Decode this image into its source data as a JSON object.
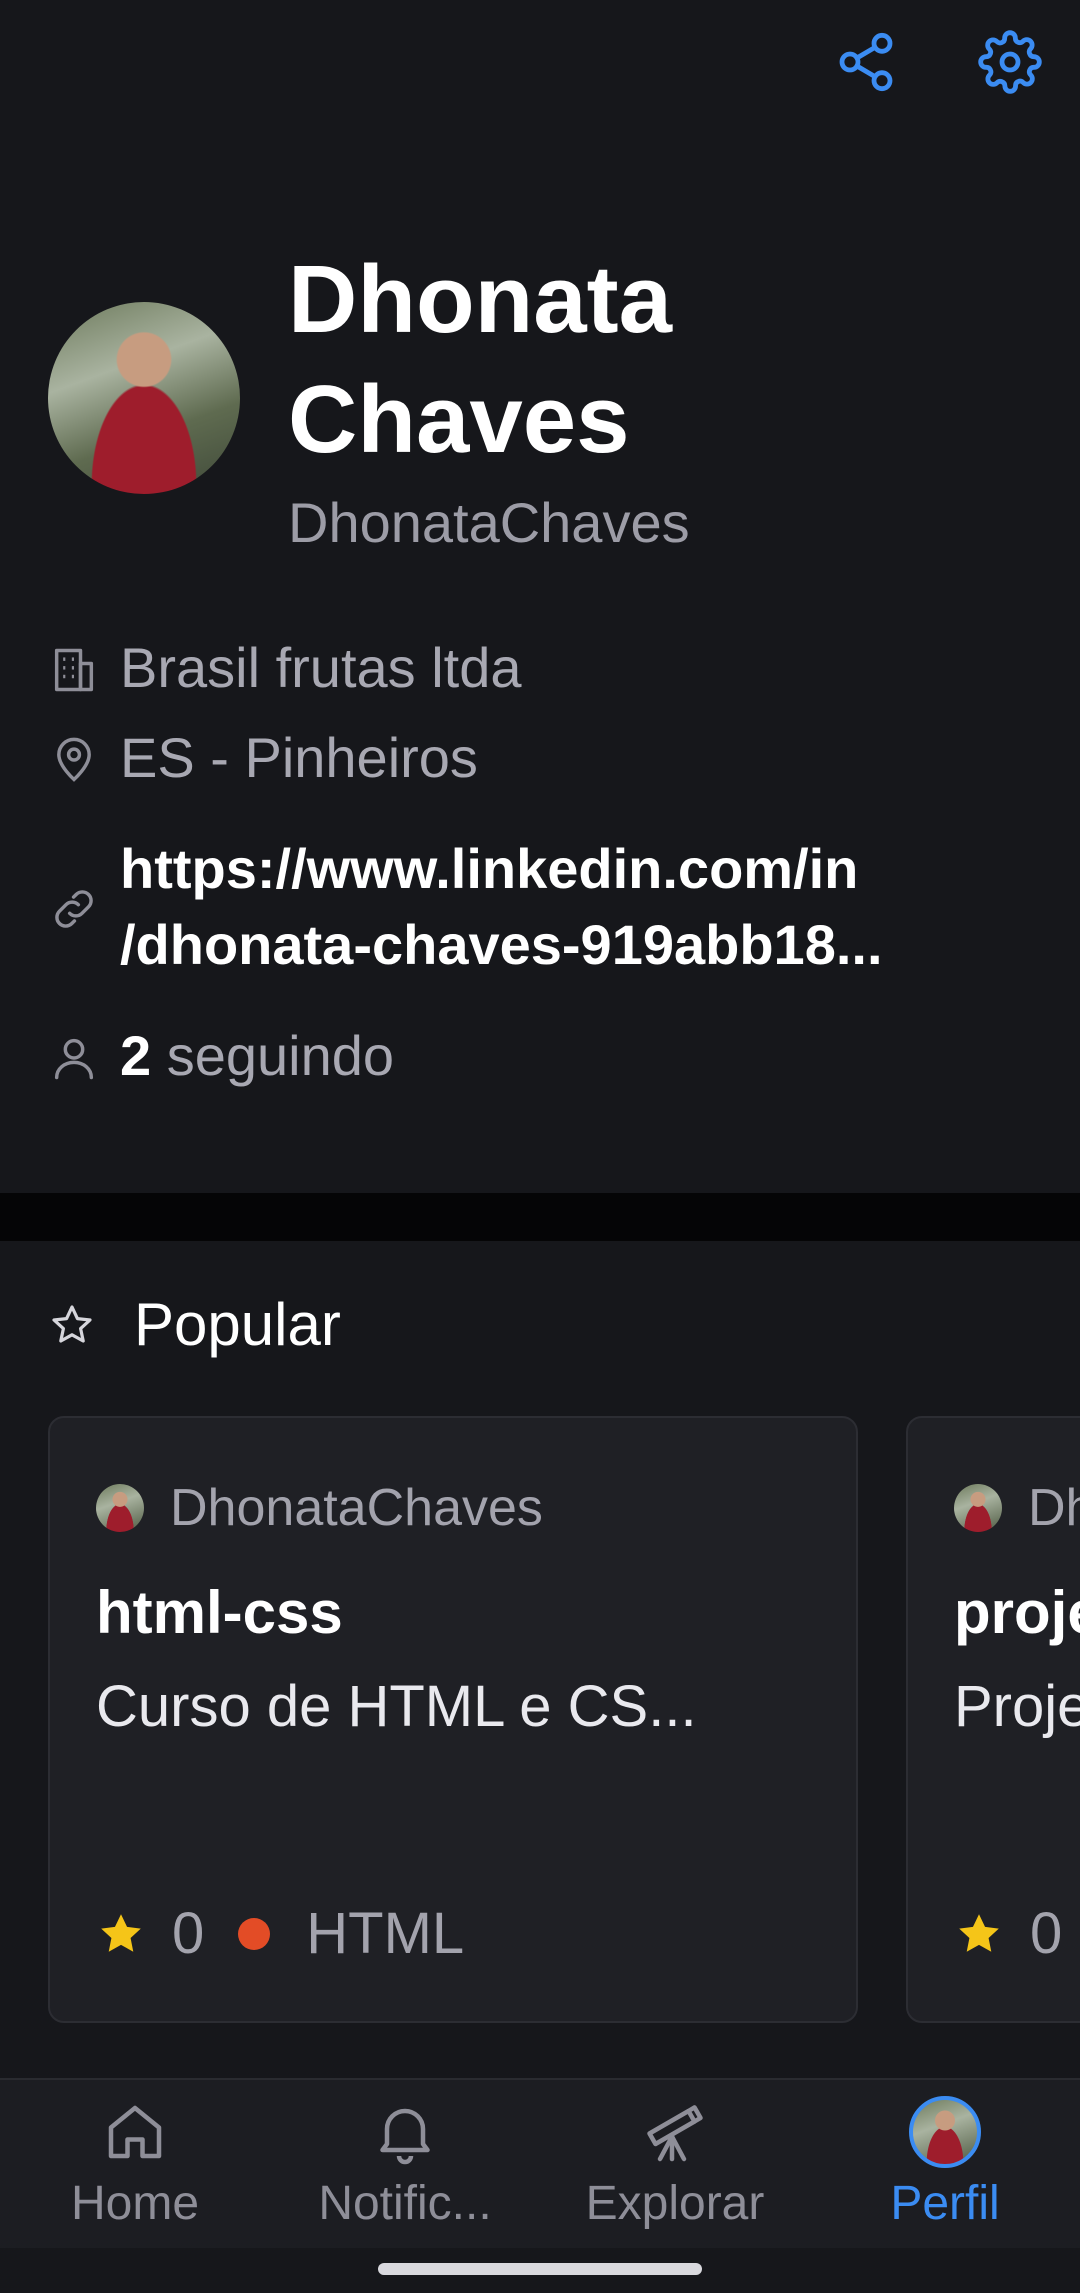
{
  "colors": {
    "accent": "#3b8cf2",
    "background": "#16171b",
    "html_lang": "#e34c26",
    "star": "#f5c518"
  },
  "top_actions": [
    {
      "name": "share",
      "icon": "share-icon"
    },
    {
      "name": "settings",
      "icon": "gear-icon"
    }
  ],
  "profile": {
    "display_name_line1": "Dhonata",
    "display_name_line2": "Chaves",
    "username": "DhonataChaves",
    "company": "Brasil frutas ltda",
    "location": "ES - Pinheiros",
    "link_line1": "https://www.linkedin.com/in",
    "link_line2": "/dhonata-chaves-919abb18...",
    "following_count": "2",
    "following_label": "seguindo"
  },
  "popular": {
    "title": "Popular",
    "repos": [
      {
        "owner": "DhonataChaves",
        "name": "html-css",
        "description": "Curso de HTML e CS...",
        "stars": "0",
        "language": "HTML",
        "language_color": "#e34c26"
      },
      {
        "owner": "DhonataChaves",
        "name": "projeto",
        "description": "Projeto",
        "stars": "0",
        "language": "",
        "language_color": "#f1e05a"
      }
    ]
  },
  "bottom_nav": [
    {
      "label": "Home",
      "icon": "home-icon",
      "active": false
    },
    {
      "label": "Notific...",
      "icon": "bell-icon",
      "active": false
    },
    {
      "label": "Explorar",
      "icon": "telescope-icon",
      "active": false
    },
    {
      "label": "Perfil",
      "icon": "avatar",
      "active": true
    }
  ]
}
